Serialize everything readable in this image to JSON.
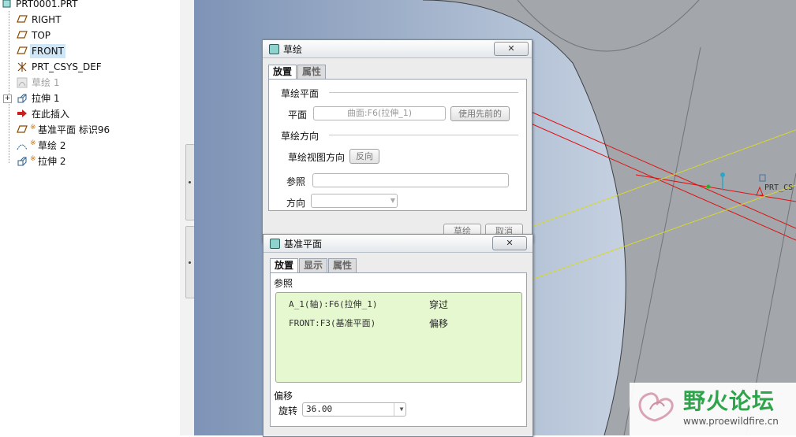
{
  "tree": {
    "items": [
      {
        "label": "PRT0001.PRT",
        "icon": "part-icon",
        "starred": false
      },
      {
        "label": "RIGHT",
        "icon": "datum-plane-icon",
        "starred": false
      },
      {
        "label": "TOP",
        "icon": "datum-plane-icon",
        "starred": false
      },
      {
        "label": "FRONT",
        "icon": "datum-plane-icon",
        "starred": false
      },
      {
        "label": "PRT_CSYS_DEF",
        "icon": "csys-icon",
        "starred": false
      },
      {
        "label": "草绘 1",
        "icon": "sketch-icon",
        "starred": false
      },
      {
        "label": "拉伸 1",
        "icon": "extrude-icon",
        "starred": false
      },
      {
        "label": "在此插入",
        "icon": "insert-here-arrow-icon",
        "starred": false
      },
      {
        "label": "基准平面 标识96",
        "icon": "datum-plane-icon",
        "starred": true
      },
      {
        "label": "草绘 2",
        "icon": "sketch-icon",
        "starred": true
      },
      {
        "label": "拉伸 2",
        "icon": "extrude-icon",
        "starred": true
      }
    ]
  },
  "viewport": {
    "csys_label": "PRT_CS"
  },
  "sketch_dialog": {
    "title": "草绘",
    "close_label": "✕",
    "tabs": [
      "放置",
      "属性"
    ],
    "section_plane": "草绘平面",
    "plane_label": "平面",
    "plane_value": "曲面:F6(拉伸_1)",
    "use_previous_label": "使用先前的",
    "section_orientation": "草绘方向",
    "view_direction_label": "草绘视图方向",
    "flip_label": "反向",
    "reference_label": "参照",
    "reference_value": "",
    "orientation_label": "方向",
    "orientation_value": "",
    "sketch_button": "草绘",
    "cancel_button": "取消"
  },
  "datum_dialog": {
    "title": "基准平面",
    "close_label": "✕",
    "tabs": [
      "放置",
      "显示",
      "属性"
    ],
    "references_label": "参照",
    "references": [
      {
        "ref": "A_1(轴):F6(拉伸_1)",
        "constraint": "穿过"
      },
      {
        "ref": "FRONT:F3(基准平面)",
        "constraint": "偏移"
      }
    ],
    "offset_section": "偏移",
    "rotate_label": "旋转",
    "rotate_value": "36.00"
  },
  "watermark": {
    "title": "野火论坛",
    "url": "www.proewildfire.cn"
  }
}
